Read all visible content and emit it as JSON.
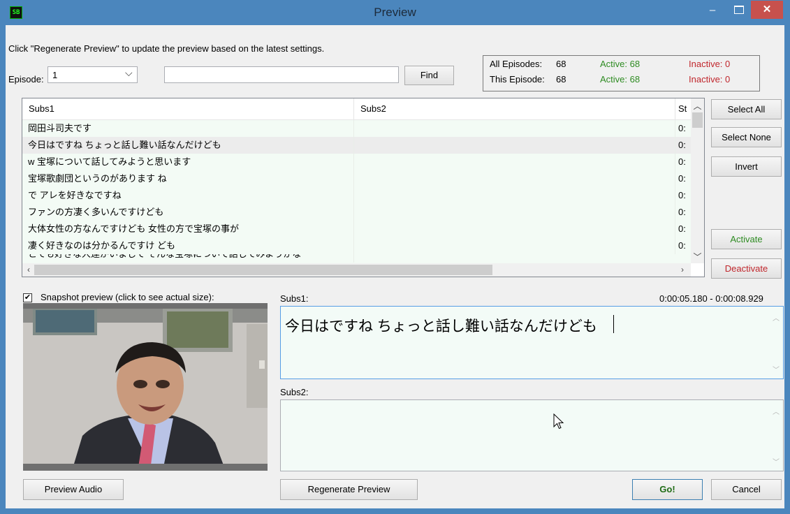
{
  "window": {
    "title": "Preview",
    "app_icon_text": "SB",
    "minimize": "–",
    "close": "✕"
  },
  "instructions": "Click \"Regenerate Preview\" to update the preview based on the latest settings.",
  "episode": {
    "label": "Episode:",
    "selected": "1",
    "chevron": "⌵"
  },
  "find": {
    "value": "",
    "button": "Find"
  },
  "stats": {
    "all_label": "All Episodes:",
    "all_count": "68",
    "all_active": "Active:  68",
    "all_inactive": "Inactive:  0",
    "this_label": "This Episode:",
    "this_count": "68",
    "this_active": "Active:  68",
    "this_inactive": "Inactive:  0"
  },
  "grid": {
    "columns": [
      "Subs1",
      "Subs2",
      "St"
    ],
    "rows": [
      {
        "subs1": "岡田斗司夫です",
        "subs2": "",
        "st": "0:"
      },
      {
        "subs1": "今日はですね ちょっと話し難い話なんだけども",
        "subs2": "",
        "st": "0:"
      },
      {
        "subs1": "w 宝塚について話してみようと思います",
        "subs2": "",
        "st": "0:"
      },
      {
        "subs1": "宝塚歌劇団というのがあります ね",
        "subs2": "",
        "st": "0:"
      },
      {
        "subs1": "で アレを好きなですね",
        "subs2": "",
        "st": "0:"
      },
      {
        "subs1": "ファンの方凄く多いんですけども",
        "subs2": "",
        "st": "0:"
      },
      {
        "subs1": "大体女性の方なんですけども 女性の方で宝塚の事が",
        "subs2": "",
        "st": "0:"
      },
      {
        "subs1": "凄く好きなのは分かるんですけ ども",
        "subs2": "",
        "st": "0:"
      }
    ],
    "partial_row": "とても好きな人達がいまして そんな宝塚について話してみようかな"
  },
  "side_buttons": {
    "select_all": "Select All",
    "select_none": "Select None",
    "invert": "Invert",
    "activate": "Activate",
    "deactivate": "Deactivate"
  },
  "snapshot": {
    "checked": "✔",
    "label": "Snapshot preview (click to see actual size):"
  },
  "subs1": {
    "label": "Subs1:",
    "time_range": "0:00:05.180  -  0:00:08.929",
    "text": "今日はですね ちょっと話し難い話なんだけども"
  },
  "subs2": {
    "label": "Subs2:",
    "text": ""
  },
  "bottom": {
    "preview_audio": "Preview Audio",
    "regenerate": "Regenerate Preview",
    "go": "Go!",
    "cancel": "Cancel"
  },
  "colors": {
    "titlebar": "#4b86bd",
    "close": "#c7514d",
    "active": "#2e8b22",
    "inactive": "#c0262c"
  }
}
